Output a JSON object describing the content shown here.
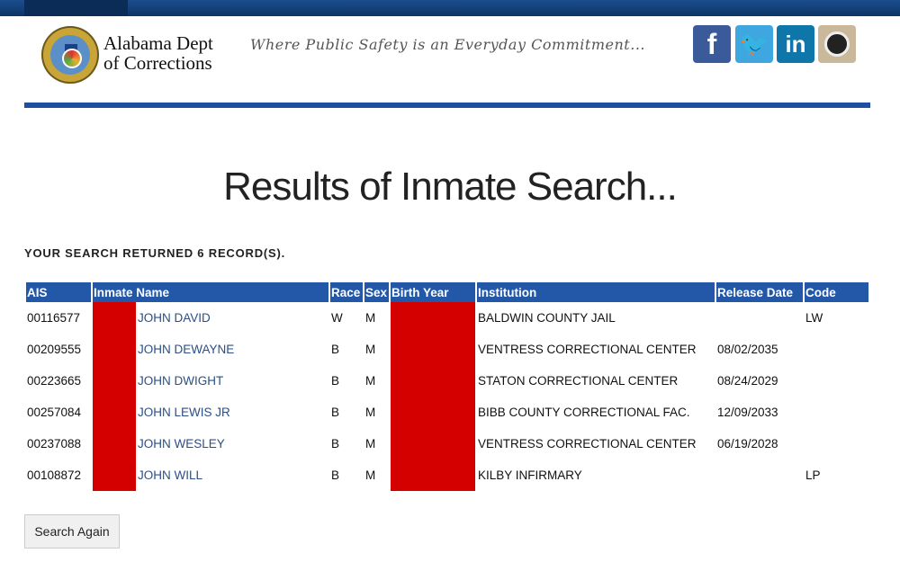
{
  "header": {
    "brand_line1": "Alabama Dept",
    "brand_line2": "of Corrections",
    "tagline": "Where Public Safety is an Everyday Commitment...",
    "social": [
      {
        "name": "facebook",
        "glyph": "f"
      },
      {
        "name": "twitter",
        "glyph": "🐦"
      },
      {
        "name": "linkedin",
        "glyph": "in"
      },
      {
        "name": "instagram",
        "glyph": ""
      }
    ]
  },
  "page_title": "Results of Inmate Search...",
  "result_count_text": "YOUR SEARCH RETURNED 6 RECORD(S).",
  "table": {
    "columns": [
      "AIS",
      "Inmate Name",
      "Race",
      "Sex",
      "Birth Year",
      "Institution",
      "Release Date",
      "Code"
    ],
    "rows": [
      {
        "ais": "00116577",
        "name": "JOHN DAVID",
        "race": "W",
        "sex": "M",
        "institution": "BALDWIN COUNTY JAIL",
        "release_date": "",
        "code": "LW"
      },
      {
        "ais": "00209555",
        "name": "JOHN DEWAYNE",
        "race": "B",
        "sex": "M",
        "institution": "VENTRESS CORRECTIONAL CENTER",
        "release_date": "08/02/2035",
        "code": ""
      },
      {
        "ais": "00223665",
        "name": "JOHN DWIGHT",
        "race": "B",
        "sex": "M",
        "institution": "STATON CORRECTIONAL CENTER",
        "release_date": "08/24/2029",
        "code": ""
      },
      {
        "ais": "00257084",
        "name": "JOHN LEWIS JR",
        "race": "B",
        "sex": "M",
        "institution": "BIBB COUNTY CORRECTIONAL FAC.",
        "release_date": "12/09/2033",
        "code": ""
      },
      {
        "ais": "00237088",
        "name": "JOHN WESLEY",
        "race": "B",
        "sex": "M",
        "institution": "VENTRESS CORRECTIONAL CENTER",
        "release_date": "06/19/2028",
        "code": ""
      },
      {
        "ais": "00108872",
        "name": "JOHN WILL",
        "race": "B",
        "sex": "M",
        "institution": "KILBY INFIRMARY",
        "release_date": "",
        "code": "LP"
      }
    ]
  },
  "search_again_label": "Search Again",
  "colors": {
    "header_blue": "#2358a8",
    "redaction": "#d40000",
    "link": "#2b4f86"
  }
}
